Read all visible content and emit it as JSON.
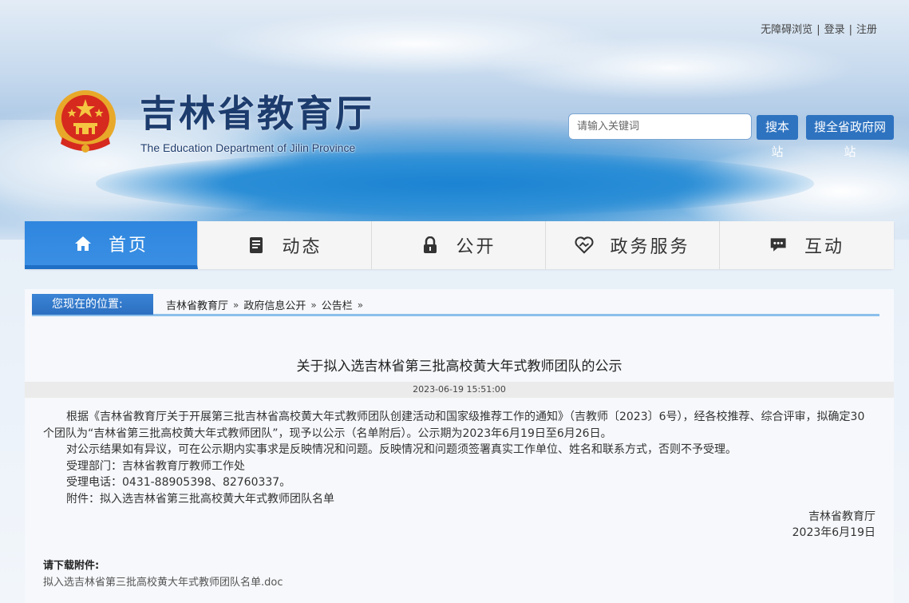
{
  "top_links": {
    "accessibility": "无障碍浏览",
    "login": "登录",
    "register": "注册",
    "separator": "|"
  },
  "header": {
    "title": "吉林省教育厅",
    "subtitle": "The Education Department of Jilin Province",
    "search_placeholder": "请输入关键词",
    "search_site_label": "搜本站",
    "search_province_label": "搜全省政府网站"
  },
  "nav": {
    "items": [
      {
        "label": "首页",
        "icon": "home-icon",
        "active": true
      },
      {
        "label": "动态",
        "icon": "document-icon"
      },
      {
        "label": "公开",
        "icon": "lock-icon"
      },
      {
        "label": "政务服务",
        "icon": "handshake-heart-icon"
      },
      {
        "label": "互动",
        "icon": "chat-icon"
      }
    ]
  },
  "breadcrumb": {
    "label": "您现在的位置:",
    "items": [
      "吉林省教育厅",
      "政府信息公开",
      "公告栏"
    ],
    "separator": "»"
  },
  "article": {
    "title": "关于拟入选吉林省第三批高校黄大年式教师团队的公示",
    "datetime": "2023-06-19 15:51:00",
    "paragraphs": [
      "根据《吉林省教育厅关于开展第三批吉林省高校黄大年式教师团队创建活动和国家级推荐工作的通知》（吉教师〔2023〕6号），经各校推荐、综合评审，拟确定30个团队为“吉林省第三批高校黄大年式教师团队”，现予以公示（名单附后）。公示期为2023年6月19日至6月26日。",
      "对公示结果如有异议，可在公示期内实事求是反映情况和问题。反映情况和问题须签署真实工作单位、姓名和联系方式，否则不予受理。",
      "受理部门：吉林省教育厅教师工作处",
      "受理电话：0431-88905398、82760337。",
      "附件：拟入选吉林省第三批高校黄大年式教师团队名单"
    ],
    "signature_org": "吉林省教育厅",
    "signature_date": "2023年6月19日",
    "download_title": "请下载附件:",
    "download_file": "拟入选吉林省第三批高校黄大年式教师团队名单.doc"
  },
  "colors": {
    "brand_blue": "#2e73c0",
    "nav_active": "#3a8fe4",
    "title_navy": "#1d3c6e"
  }
}
